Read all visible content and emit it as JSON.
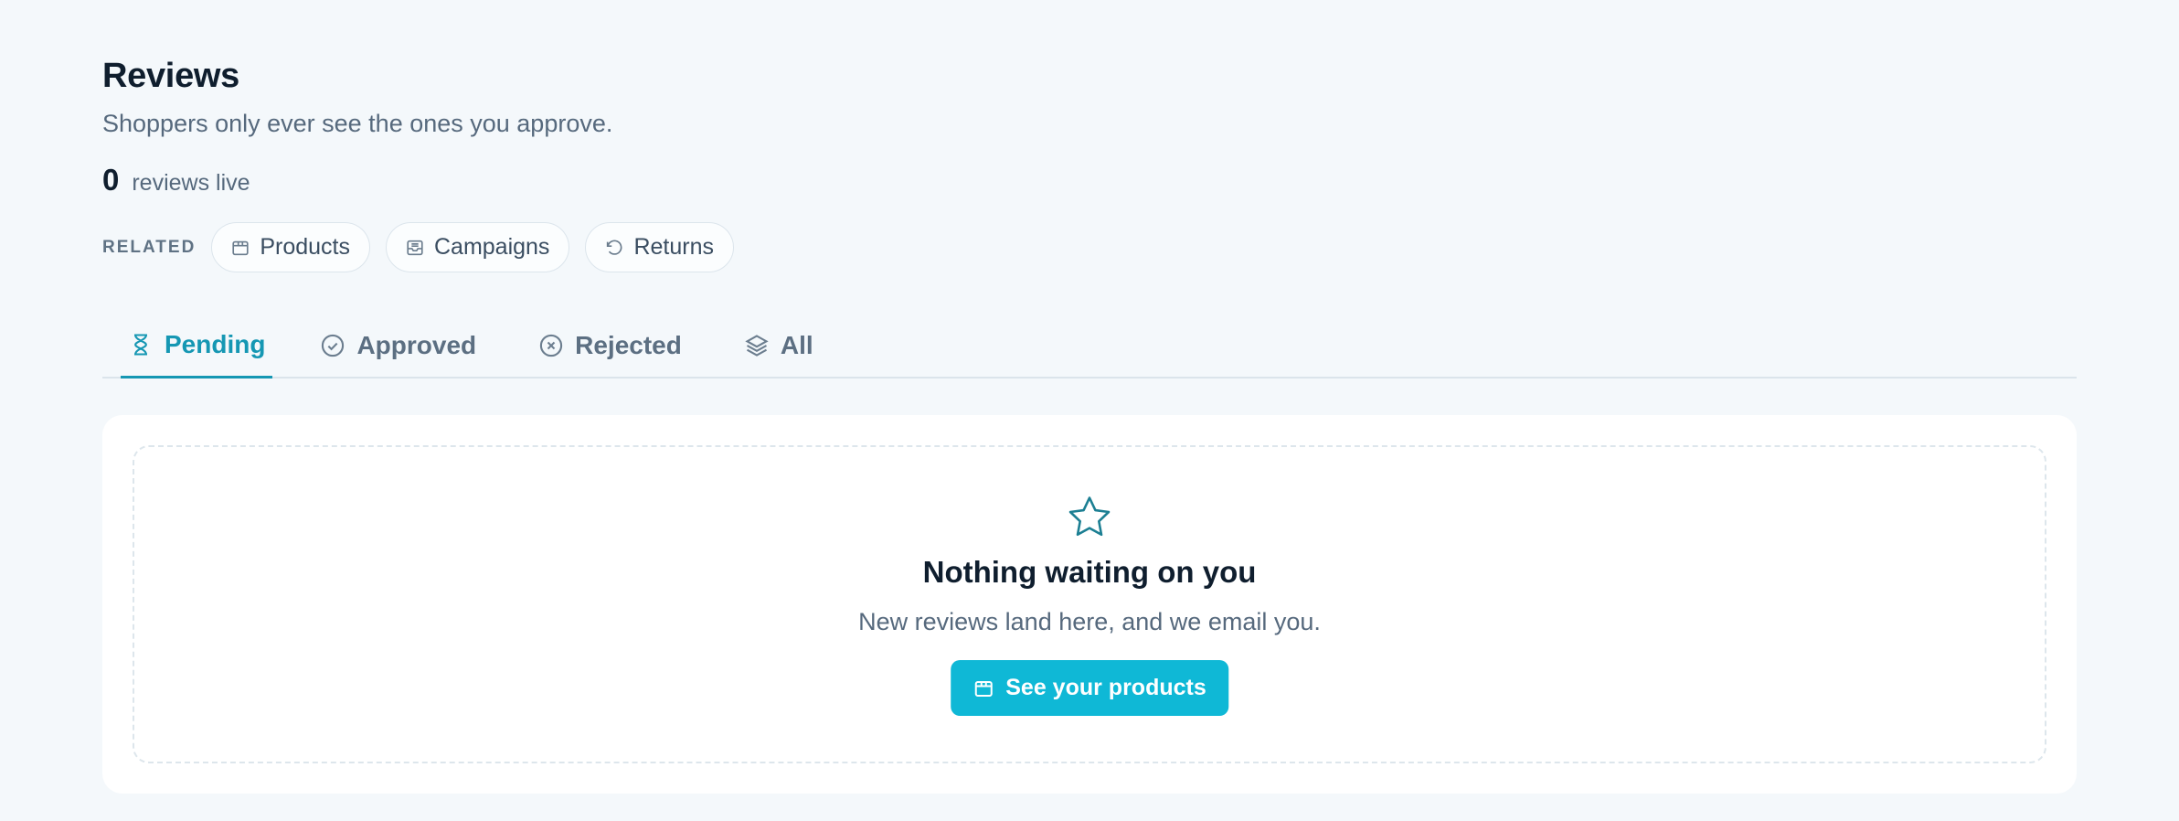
{
  "header": {
    "title": "Reviews",
    "subtitle": "Shoppers only ever see the ones you approve.",
    "live_count": "0",
    "live_label": "reviews live"
  },
  "related": {
    "label": "RELATED",
    "items": [
      {
        "label": "Products",
        "icon": "box-icon"
      },
      {
        "label": "Campaigns",
        "icon": "inbox-icon"
      },
      {
        "label": "Returns",
        "icon": "undo-icon"
      }
    ]
  },
  "tabs": [
    {
      "label": "Pending",
      "icon": "hourglass-icon",
      "active": true
    },
    {
      "label": "Approved",
      "icon": "check-circle-icon",
      "active": false
    },
    {
      "label": "Rejected",
      "icon": "x-circle-icon",
      "active": false
    },
    {
      "label": "All",
      "icon": "layers-icon",
      "active": false
    }
  ],
  "empty_state": {
    "icon": "star-icon",
    "title": "Nothing waiting on you",
    "text": "New reviews land here, and we email you.",
    "button_label": "See your products",
    "button_icon": "box-icon"
  },
  "colors": {
    "accent": "#1597b3",
    "button": "#0fb8d6",
    "background": "#f4f8fb"
  }
}
